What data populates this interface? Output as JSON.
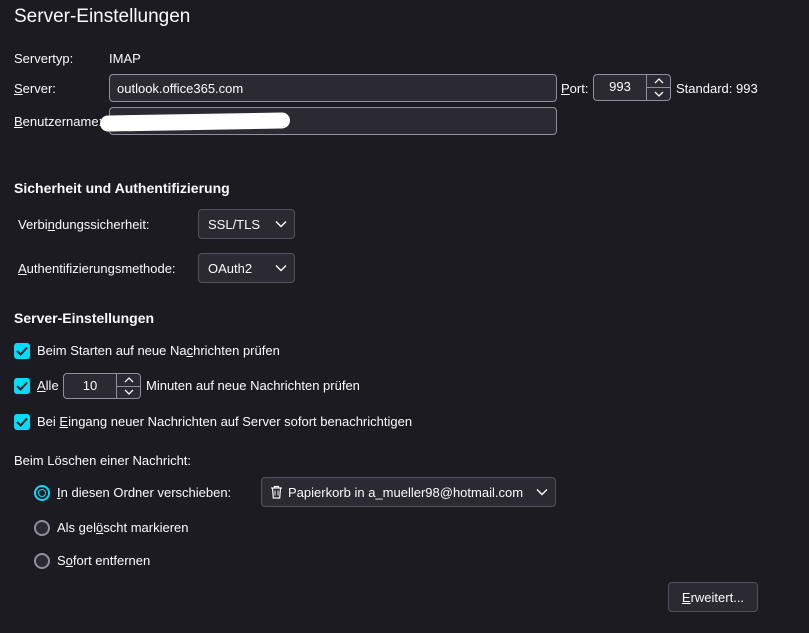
{
  "page_title": "Server-Einstellungen",
  "server_type": {
    "label": "Servertyp:",
    "value": "IMAP"
  },
  "server": {
    "label_pre": "",
    "label_access": "S",
    "label_post": "erver:",
    "value": "outlook.office365.com"
  },
  "port": {
    "label_access": "P",
    "label_post": "ort:",
    "value": "993",
    "default_text": "Standard: 993"
  },
  "username": {
    "label_access": "B",
    "label_post": "enutzername:",
    "value": ""
  },
  "security_section": {
    "title": "Sicherheit und Authentifizierung",
    "connection": {
      "label_pre": "Verbi",
      "label_access": "n",
      "label_post": "dungssicherheit:",
      "value": "SSL/TLS"
    },
    "auth": {
      "label_pre": "",
      "label_access": "A",
      "label_post": "uthentifizierungsmethode:",
      "value": "OAuth2"
    }
  },
  "server_settings": {
    "title": "Server-Einstellungen",
    "check_startup": {
      "pre": "Beim Starten auf neue Na",
      "access": "c",
      "post": "hrichten prüfen",
      "checked": true
    },
    "check_every": {
      "pre": "",
      "access": "A",
      "post": "lle",
      "checked": true,
      "interval": "10",
      "suffix": "Minuten auf neue Nachrichten prüfen"
    },
    "check_notify": {
      "pre": "Bei ",
      "access": "E",
      "post": "ingang neuer Nachrichten auf Server sofort benachrichtigen",
      "checked": true
    }
  },
  "delete_section": {
    "label": "Beim Löschen einer Nachricht:",
    "move": {
      "pre": "",
      "access": "I",
      "post": "n diesen Ordner verschieben:",
      "checked": true,
      "folder": "Papierkorb in a_mueller98@hotmail.com"
    },
    "mark": {
      "pre": "Als gel",
      "access": "ö",
      "post": "scht markieren",
      "checked": false
    },
    "remove": {
      "pre": "S",
      "access": "o",
      "post": "fort entfernen",
      "checked": false
    }
  },
  "advanced_button": {
    "access": "E",
    "post": "rweitert..."
  },
  "colors": {
    "background": "#1c1b22",
    "field": "#2b2a33",
    "accent": "#00ddff",
    "text": "#fbfbfe"
  }
}
